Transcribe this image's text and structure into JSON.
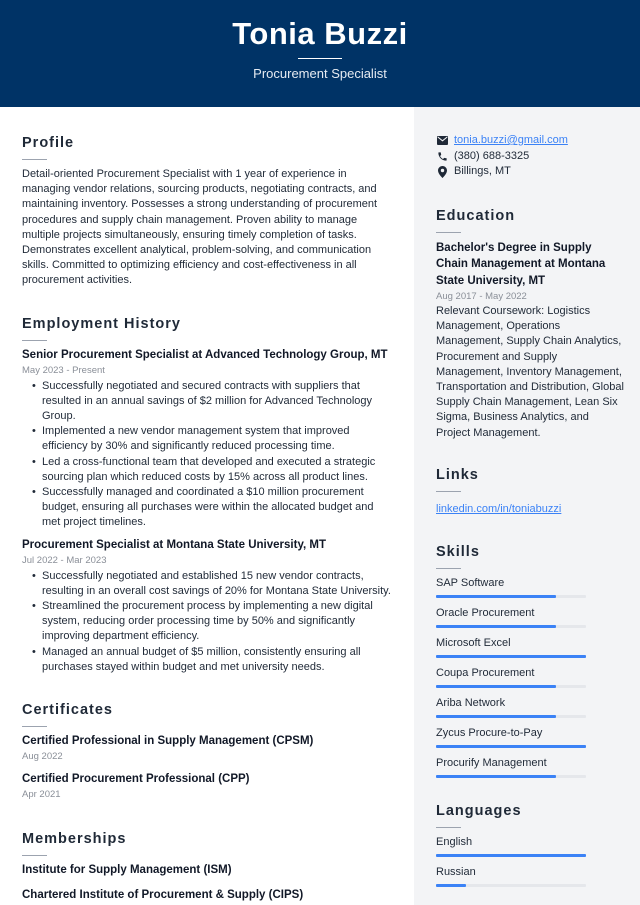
{
  "header": {
    "name": "Tonia Buzzi",
    "title": "Procurement Specialist",
    "background_color": "#003366"
  },
  "profile": {
    "heading": "Profile",
    "text": "Detail-oriented Procurement Specialist with 1 year of experience in managing vendor relations, sourcing products, negotiating contracts, and maintaining inventory. Possesses a strong understanding of procurement procedures and supply chain management. Proven ability to manage multiple projects simultaneously, ensuring timely completion of tasks. Demonstrates excellent analytical, problem-solving, and communication skills. Committed to optimizing efficiency and cost-effectiveness in all procurement activities."
  },
  "employment": {
    "heading": "Employment History",
    "jobs": [
      {
        "title": "Senior Procurement Specialist at Advanced Technology Group, MT",
        "dates": "May 2023 - Present",
        "bullets": [
          "Successfully negotiated and secured contracts with suppliers that resulted in an annual savings of $2 million for Advanced Technology Group.",
          "Implemented a new vendor management system that improved efficiency by 30% and significantly reduced processing time.",
          "Led a cross-functional team that developed and executed a strategic sourcing plan which reduced costs by 15% across all product lines.",
          "Successfully managed and coordinated a $10 million procurement budget, ensuring all purchases were within the allocated budget and met project timelines."
        ]
      },
      {
        "title": "Procurement Specialist at Montana State University, MT",
        "dates": "Jul 2022 - Mar 2023",
        "bullets": [
          "Successfully negotiated and established 15 new vendor contracts, resulting in an overall cost savings of 20% for Montana State University.",
          "Streamlined the procurement process by implementing a new digital system, reducing order processing time by 50% and significantly improving department efficiency.",
          "Managed an annual budget of $5 million, consistently ensuring all purchases stayed within budget and met university needs."
        ]
      }
    ]
  },
  "certificates": {
    "heading": "Certificates",
    "items": [
      {
        "title": "Certified Professional in Supply Management (CPSM)",
        "date": "Aug 2022"
      },
      {
        "title": "Certified Procurement Professional (CPP)",
        "date": "Apr 2021"
      }
    ]
  },
  "memberships": {
    "heading": "Memberships",
    "items": [
      "Institute for Supply Management (ISM)",
      "Chartered Institute of Procurement & Supply (CIPS)"
    ]
  },
  "contact": {
    "email": "tonia.buzzi@gmail.com",
    "phone": "(380) 688-3325",
    "location": "Billings, MT",
    "icons": [
      "envelope-icon",
      "phone-icon",
      "map-pin-icon"
    ]
  },
  "education": {
    "heading": "Education",
    "degree": "Bachelor's Degree in Supply Chain Management at Montana State University, MT",
    "dates": "Aug 2017 - May 2022",
    "description": "Relevant Coursework: Logistics Management, Operations Management, Supply Chain Analytics, Procurement and Supply Management, Inventory Management, Transportation and Distribution, Global Supply Chain Management, Lean Six Sigma, Business Analytics, and Project Management."
  },
  "links": {
    "heading": "Links",
    "items": [
      "linkedin.com/in/toniabuzzi"
    ]
  },
  "skills": {
    "heading": "Skills",
    "items": [
      {
        "name": "SAP Software",
        "level": 0.8
      },
      {
        "name": "Oracle Procurement",
        "level": 0.8
      },
      {
        "name": "Microsoft Excel",
        "level": 1.0
      },
      {
        "name": "Coupa Procurement",
        "level": 0.8
      },
      {
        "name": "Ariba Network",
        "level": 0.8
      },
      {
        "name": "Zycus Procure-to-Pay",
        "level": 1.0
      },
      {
        "name": "Procurify Management",
        "level": 0.8
      }
    ]
  },
  "languages": {
    "heading": "Languages",
    "items": [
      {
        "name": "English",
        "level": 1.0
      },
      {
        "name": "Russian",
        "level": 0.2
      }
    ]
  },
  "colors": {
    "accent": "#3b82f6",
    "sidebar_bg": "#f3f4f6",
    "bar_track": "#e5e7eb"
  }
}
